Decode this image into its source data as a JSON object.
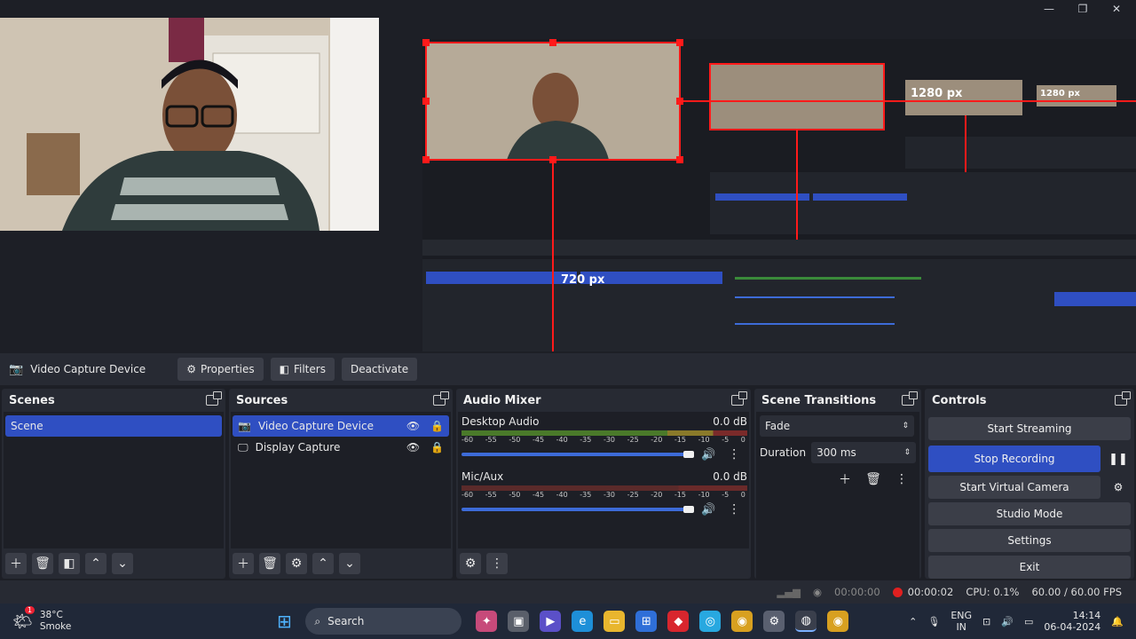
{
  "window": {
    "minimize": "—",
    "maximize": "❐",
    "close": "✕"
  },
  "preview": {
    "label_width": "1280 px",
    "label_height": "720 px",
    "nested_width": "1280 px"
  },
  "sourcebar": {
    "source_name": "Video Capture Device",
    "properties": "Properties",
    "filters": "Filters",
    "deactivate": "Deactivate"
  },
  "scenes": {
    "title": "Scenes",
    "items": [
      "Scene"
    ]
  },
  "sources": {
    "title": "Sources",
    "items": [
      "Video Capture Device",
      "Display Capture"
    ]
  },
  "audio": {
    "title": "Audio Mixer",
    "ticks": [
      "-60",
      "-55",
      "-50",
      "-45",
      "-40",
      "-35",
      "-30",
      "-25",
      "-20",
      "-15",
      "-10",
      "-5",
      "0"
    ],
    "channels": [
      {
        "name": "Desktop Audio",
        "db": "0.0 dB"
      },
      {
        "name": "Mic/Aux",
        "db": "0.0 dB"
      }
    ]
  },
  "transitions": {
    "title": "Scene Transitions",
    "type": "Fade",
    "duration_label": "Duration",
    "duration_value": "300 ms"
  },
  "controls": {
    "title": "Controls",
    "start_streaming": "Start Streaming",
    "stop_recording": "Stop Recording",
    "start_virtual_camera": "Start Virtual Camera",
    "studio_mode": "Studio Mode",
    "settings": "Settings",
    "exit": "Exit"
  },
  "status": {
    "stream_time": "00:00:00",
    "record_time": "00:00:02",
    "cpu": "CPU: 0.1%",
    "fps": "60.00 / 60.00 FPS"
  },
  "taskbar": {
    "weather_temp": "38°C",
    "weather_desc": "Smoke",
    "weather_badge": "1",
    "search": "Search",
    "lang_1": "ENG",
    "lang_2": "IN",
    "time": "14:14",
    "date": "06-04-2024"
  },
  "colors": {
    "accent": "#2f4fc2",
    "record": "#e02020",
    "selection": "#ff1a1a"
  }
}
